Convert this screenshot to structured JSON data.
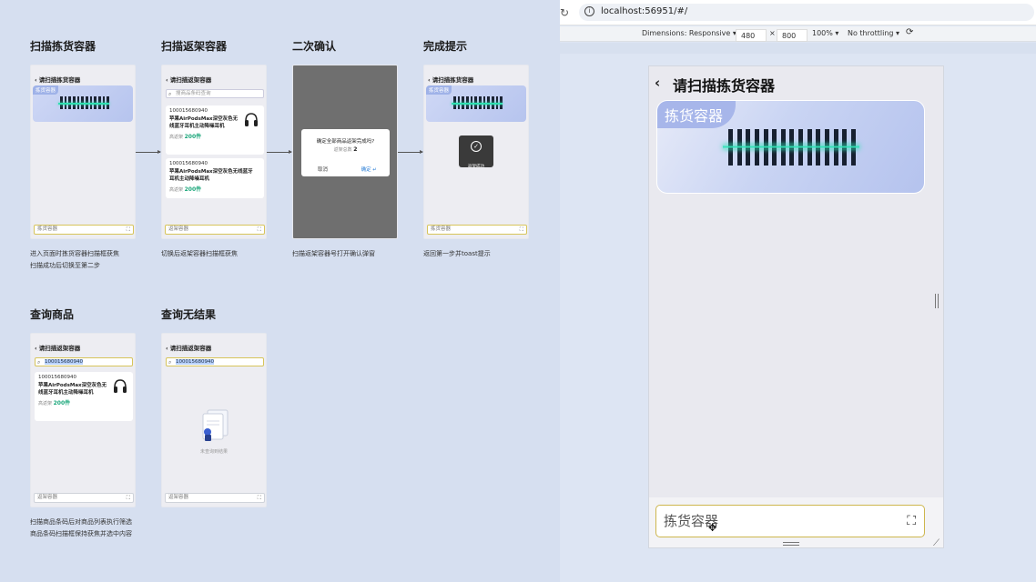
{
  "board": {
    "titles": [
      "扫描拣货容器",
      "扫描返架容器",
      "二次确认",
      "完成提示",
      "查询商品",
      "查询无结果"
    ],
    "phone_header_pick": "请扫描拣货容器",
    "phone_header_return": "请扫描返架容器",
    "banner_tag": "拣货容器",
    "search_placeholder": "搜商品条码查询",
    "search_query": "100015680940",
    "card1": {
      "code": "100015680940",
      "name": "苹果AirPodsMax深空灰色无线蓝牙耳机主动降噪耳机",
      "stock_label": "高返架",
      "stock_value": "200件"
    },
    "card2": {
      "code": "100015680940",
      "name": "苹果AirPodsMax深空灰色无线蓝牙耳机主动降噪耳机",
      "stock_label": "高返架",
      "stock_value": "200件"
    },
    "input_pick": "拣货容器",
    "input_return": "返架容器",
    "dialog": {
      "question": "确定全部商品返架完成吗?",
      "count_label": "返架总数",
      "count_value": "2",
      "cancel": "取消",
      "ok": "确定 ↵"
    },
    "toast_text": "返架成功",
    "empty_text": "未查询到结果",
    "descs": {
      "d1_line1": "进入页面时拣货容器扫描框获焦",
      "d1_line2": "扫描成功后切换至第二步",
      "d2": "切换后返架容器扫描框获焦",
      "d3": "扫描返架容器号打开确认弹窗",
      "d4": "返回第一步并toast提示",
      "d5_line1": "扫描商品条码后对商品列表执行筛选",
      "d5_line2": "商品条码扫描框保持获焦并选中内容"
    }
  },
  "browser": {
    "url": "localhost:56951/#/",
    "dimensions_label": "Dimensions: Responsive ▾",
    "width": "480",
    "times": "×",
    "height": "800",
    "zoom": "100% ▾",
    "throttling": "No throttling ▾",
    "reload_icon": "↻",
    "rotate_icon": "⟳"
  },
  "device": {
    "back_icon": "‹",
    "title": "请扫描拣货容器",
    "banner_tag": "拣货容器",
    "input_value": "拣货容器",
    "scan_icon": "⛶",
    "cursor_icon": "✥"
  }
}
